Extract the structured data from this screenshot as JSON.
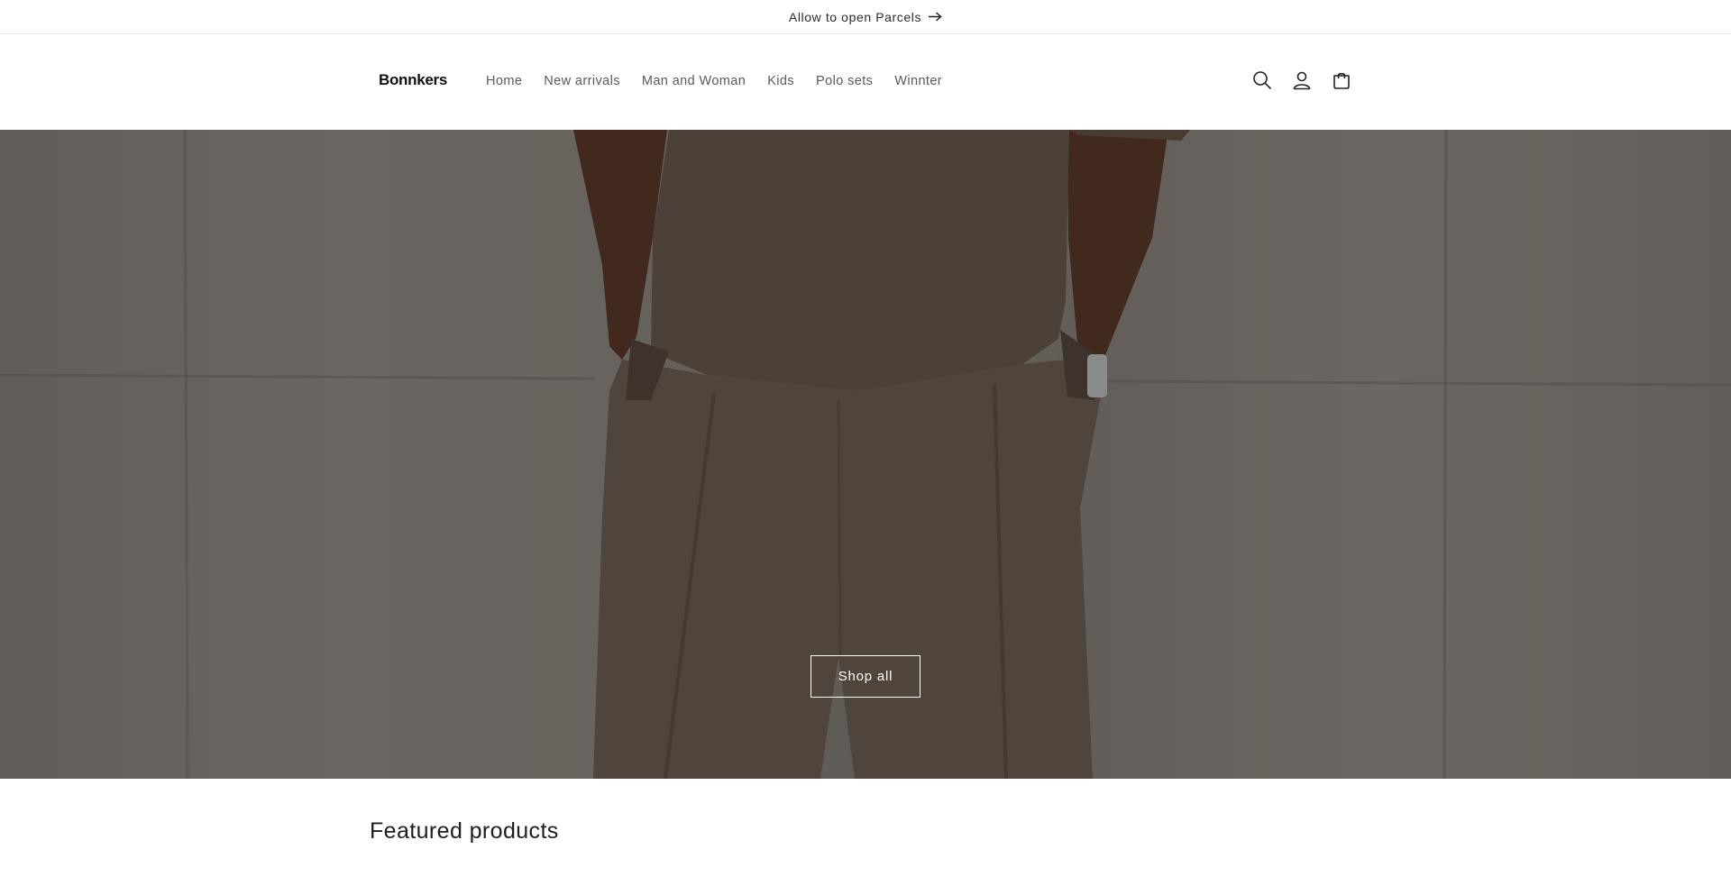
{
  "announcement": {
    "text": "Allow to open Parcels",
    "arrow_icon": "arrow-right-icon"
  },
  "header": {
    "logo": "Bonnkers",
    "nav": [
      {
        "label": "Home"
      },
      {
        "label": "New arrivals"
      },
      {
        "label": "Man and Woman"
      },
      {
        "label": "Kids"
      },
      {
        "label": "Polo sets"
      },
      {
        "label": "Winnter"
      }
    ],
    "icons": [
      "search-icon",
      "account-icon",
      "cart-icon"
    ]
  },
  "hero": {
    "button_label": "Shop all"
  },
  "featured": {
    "title": "Featured products"
  },
  "colors": {
    "text": "#121212",
    "hero_wall": "#75706a",
    "garment": "#5a4e44",
    "skin": "#4a2f22",
    "white": "#ffffff"
  }
}
